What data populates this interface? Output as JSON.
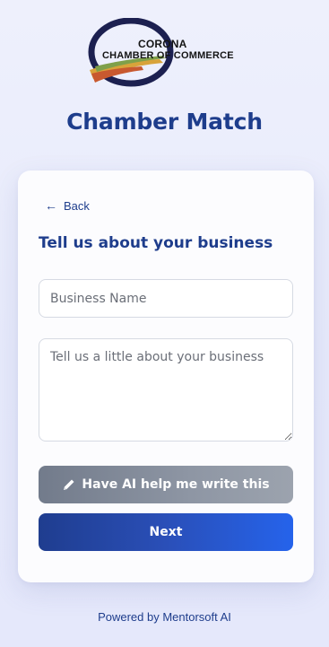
{
  "logo": {
    "line1": "CORONA",
    "line2": "CHAMBER OF COMMERCE"
  },
  "app": {
    "title": "Chamber Match"
  },
  "form": {
    "back_label": "Back",
    "heading": "Tell us about your business",
    "business_name_placeholder": "Business Name",
    "description_placeholder": "Tell us a little about your business",
    "ai_button_label": "Have AI help me write this",
    "next_button_label": "Next"
  },
  "footer": {
    "text": "Powered by Mentorsoft AI"
  },
  "icons": {
    "back": "arrow-left-icon",
    "ai": "pencil-icon"
  },
  "colors": {
    "brand": "#1e3d8c",
    "primary_button": "#2563eb",
    "ai_button": "#8e96a4"
  }
}
